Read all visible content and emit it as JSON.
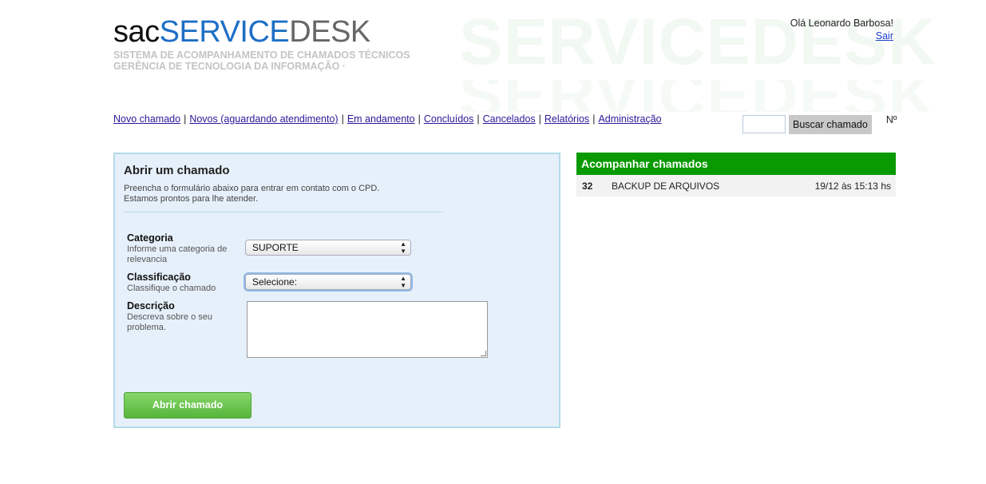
{
  "brand": {
    "sac": "sac",
    "service": "SERVICE",
    "desk": "DESK",
    "watermark": "SERVICEDESK",
    "subtitle1": "SISTEMA DE ACOMPANHAMENTO DE CHAMADOS TÉCNICOS",
    "subtitle2": "GERÊNCIA DE TECNOLOGIA DA INFORMAÇÃO ·"
  },
  "user": {
    "greeting": "Olá Leonardo Barbosa!",
    "logout": "Sair"
  },
  "nav": {
    "items": [
      "Novo chamado",
      "Novos (aguardando atendimento)",
      "Em andamento",
      "Concluídos",
      "Cancelados",
      "Relatórios",
      "Administração"
    ],
    "separator": "|"
  },
  "search": {
    "value": "",
    "button_label": "Buscar chamado",
    "suffix": "Nº"
  },
  "form": {
    "title": "Abrir um chamado",
    "desc_line1": "Preencha o formulário abaixo para entrar em contato com o CPD.",
    "desc_line2": "Estamos prontos para lhe atender.",
    "categoria": {
      "label": "Categoria",
      "help": "Informe uma categoria de relevancia",
      "selected": "SUPORTE"
    },
    "classificacao": {
      "label": "Classificação",
      "help": "Classifique o chamado",
      "selected": "Selecione:"
    },
    "descricao": {
      "label": "Descrição",
      "help": "Descreva sobre o seu problema.",
      "value": ""
    },
    "submit_label": "Abrir chamado"
  },
  "tracking": {
    "title": "Acompanhar chamados",
    "rows": [
      {
        "number": "32",
        "title": "BACKUP DE ARQUIVOS",
        "date": "19/12 às 15:13 hs"
      }
    ]
  },
  "colors": {
    "brand_blue": "#1e6fc5",
    "brand_gray": "#666666",
    "panel_bg": "#e6f0fa",
    "panel_border": "#b3dbe8",
    "track_header": "#099a02",
    "submit_green": "#56b53a"
  }
}
